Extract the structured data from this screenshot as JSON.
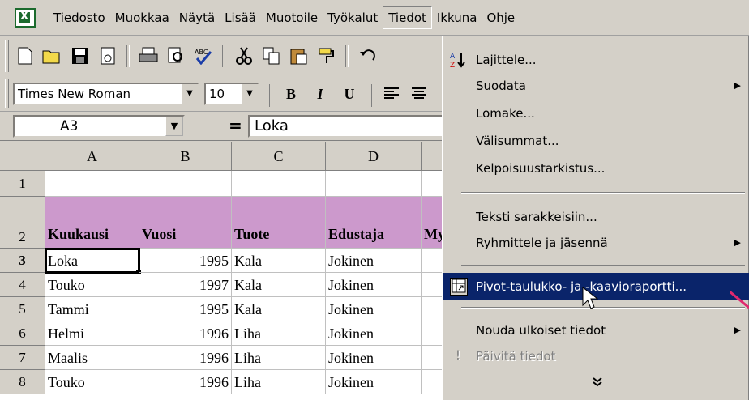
{
  "menubar": {
    "items": [
      "Tiedosto",
      "Muokkaa",
      "Näytä",
      "Lisää",
      "Muotoile",
      "Työkalut",
      "Tiedot",
      "Ikkuna",
      "Ohje"
    ],
    "open_index": 6
  },
  "format_toolbar": {
    "font": "Times New Roman",
    "size": "10",
    "bold": "B",
    "italic": "I",
    "underline": "U"
  },
  "formula_bar": {
    "name_box": "A3",
    "equals": "=",
    "value": "Loka"
  },
  "sheet": {
    "columns": [
      "A",
      "B",
      "C",
      "D"
    ],
    "rows": [
      {
        "num": "1",
        "cells": [
          "",
          "",
          "",
          ""
        ]
      },
      {
        "num": "2",
        "cells": [
          "Kuukausi",
          "Vuosi",
          "Tuote",
          "Edustaja",
          "Myy"
        ]
      },
      {
        "num": "3",
        "cells": [
          "Loka",
          "1995",
          "Kala",
          "Jokinen"
        ]
      },
      {
        "num": "4",
        "cells": [
          "Touko",
          "1997",
          "Kala",
          "Jokinen"
        ]
      },
      {
        "num": "5",
        "cells": [
          "Tammi",
          "1995",
          "Kala",
          "Jokinen"
        ]
      },
      {
        "num": "6",
        "cells": [
          "Helmi",
          "1996",
          "Liha",
          "Jokinen"
        ]
      },
      {
        "num": "7",
        "cells": [
          "Maalis",
          "1996",
          "Liha",
          "Jokinen"
        ]
      },
      {
        "num": "8",
        "cells": [
          "Touko",
          "1996",
          "Liha",
          "Jokinen"
        ]
      }
    ],
    "active_cell": "A3",
    "header_fill": "#cc99cc"
  },
  "tiedot_menu": {
    "items": [
      {
        "label": "Lajittele...",
        "icon": "sort-icon"
      },
      {
        "label": "Suodata",
        "submenu": true
      },
      {
        "label": "Lomake..."
      },
      {
        "label": "Välisummat..."
      },
      {
        "label": "Kelpoisuustarkistus..."
      },
      {
        "label": "Teksti sarakkeisiin..."
      },
      {
        "label": "Ryhmittele ja jäsennä",
        "submenu": true
      },
      {
        "label": "Pivot-taulukko- ja -kaavioraportti...",
        "icon": "pivot-icon",
        "highlighted": true
      },
      {
        "label": "Nouda ulkoiset tiedot",
        "submenu": true
      },
      {
        "label": "Päivitä tiedot",
        "icon": "refresh-icon",
        "disabled": true
      }
    ]
  },
  "colors": {
    "face": "#d4d0c8",
    "highlight": "#0a246a",
    "background": "#f0a23a",
    "pointer_line": "#e0286e"
  }
}
